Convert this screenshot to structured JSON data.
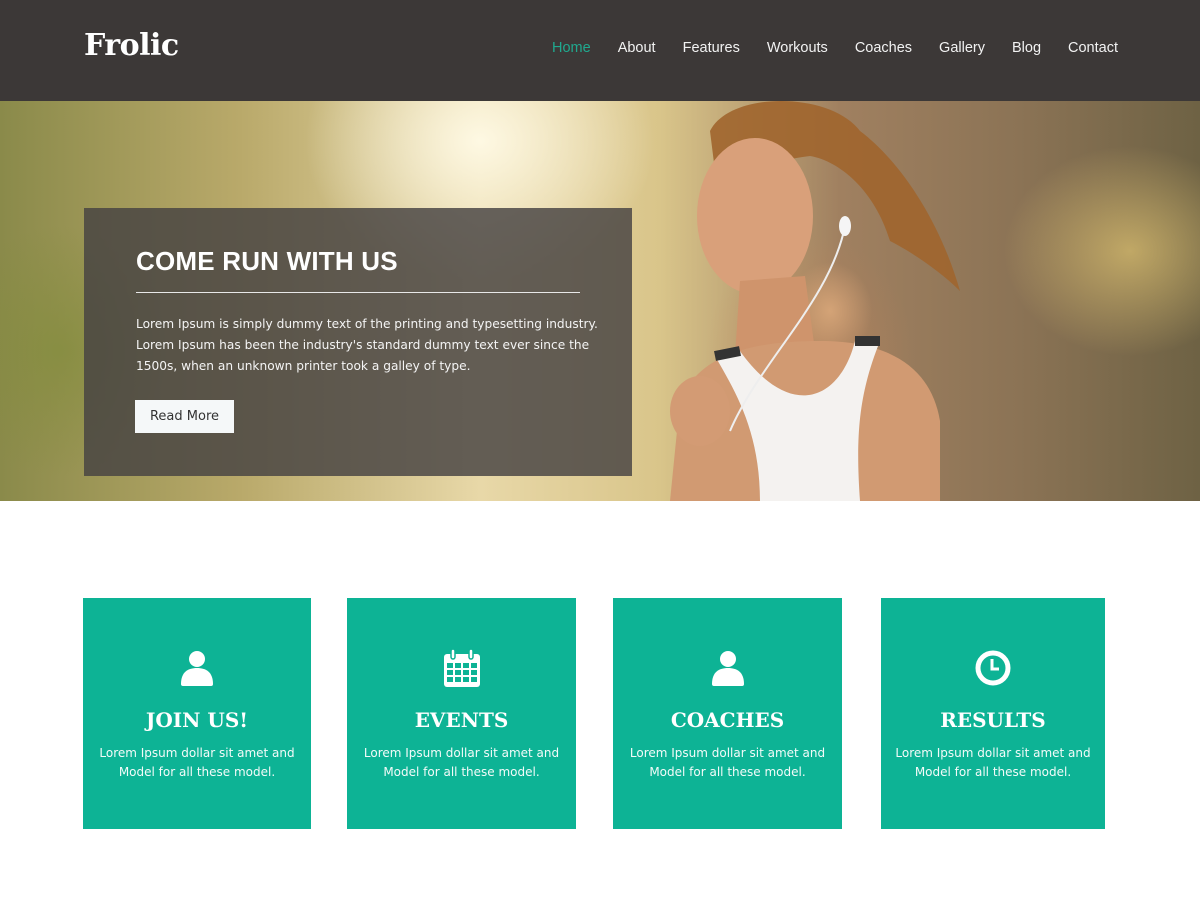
{
  "header": {
    "logo": "Frolic",
    "nav": [
      {
        "label": "Home",
        "active": true
      },
      {
        "label": "About",
        "active": false
      },
      {
        "label": "Features",
        "active": false
      },
      {
        "label": "Workouts",
        "active": false
      },
      {
        "label": "Coaches",
        "active": false
      },
      {
        "label": "Gallery",
        "active": false
      },
      {
        "label": "Blog",
        "active": false
      },
      {
        "label": "Contact",
        "active": false
      }
    ]
  },
  "hero": {
    "title": "COME RUN WITH US",
    "text": "Lorem Ipsum is simply dummy text of the printing and typesetting industry. Lorem Ipsum has been the industry's standard dummy text ever since the 1500s, when an unknown printer took a galley of type.",
    "button_label": "Read More",
    "image_alt": "woman-running-with-earphones"
  },
  "features": [
    {
      "icon": "user-icon",
      "title": "JOIN US!",
      "desc": "Lorem Ipsum dollar sit amet and Model for all these model."
    },
    {
      "icon": "calendar-icon",
      "title": "EVENTS",
      "desc": "Lorem Ipsum dollar sit amet and Model for all these model."
    },
    {
      "icon": "user-icon",
      "title": "COACHES",
      "desc": "Lorem Ipsum dollar sit amet and Model for all these model."
    },
    {
      "icon": "clock-icon",
      "title": "RESULTS",
      "desc": "Lorem Ipsum dollar sit amet and Model for all these model."
    }
  ],
  "colors": {
    "accent": "#0db395",
    "nav_active": "#20a98f",
    "header_bg": "#3c3837"
  }
}
